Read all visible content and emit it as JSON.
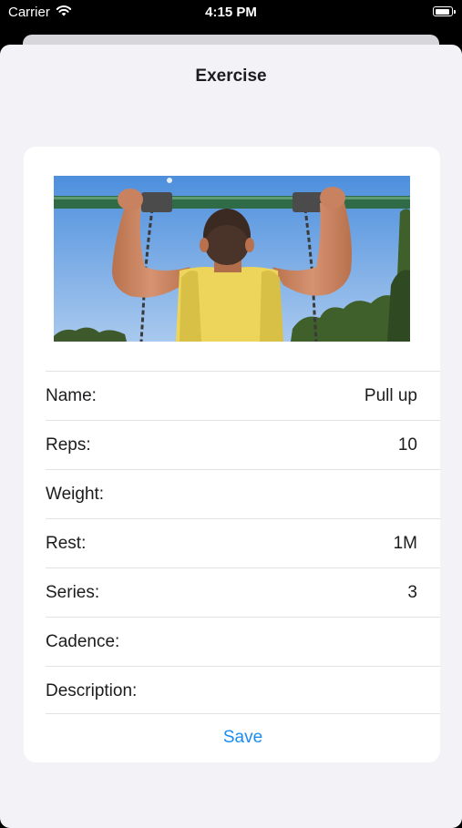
{
  "status_bar": {
    "carrier": "Carrier",
    "time": "4:15 PM",
    "icons": [
      "wifi-icon",
      "battery-icon"
    ]
  },
  "sheet": {
    "title": "Exercise"
  },
  "exercise_image": {
    "subject": "man doing pull up on bar"
  },
  "fields": [
    {
      "label": "Name:",
      "value": "Pull up"
    },
    {
      "label": "Reps:",
      "value": "10"
    },
    {
      "label": "Weight:",
      "value": ""
    },
    {
      "label": "Rest:",
      "value": "1M"
    },
    {
      "label": "Series:",
      "value": "3"
    },
    {
      "label": "Cadence:",
      "value": ""
    },
    {
      "label": "Description:",
      "value": ""
    }
  ],
  "actions": {
    "save_label": "Save"
  },
  "colors": {
    "accent": "#1a8cf2",
    "sheet_background": "#f2f2f7",
    "card_background": "#ffffff",
    "text": "#1c1c1e"
  }
}
